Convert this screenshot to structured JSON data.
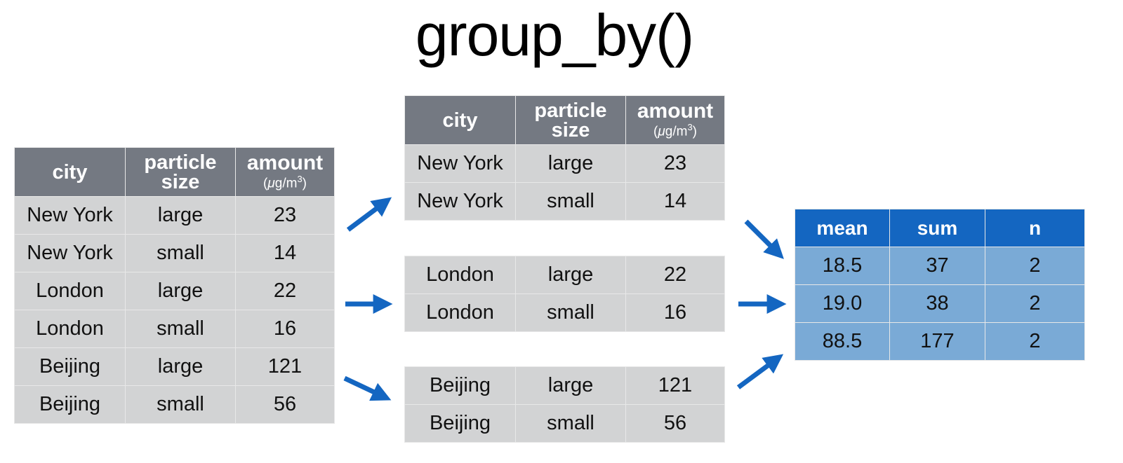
{
  "title": "group_by()",
  "columns": {
    "city": "city",
    "particle_size_line1": "particle",
    "particle_size_line2": "size",
    "amount": "amount",
    "amount_unit_prefix": "(",
    "amount_unit_mu": "μ",
    "amount_unit_mid": "g/m",
    "amount_unit_exp": "3",
    "amount_unit_suffix": ")"
  },
  "source_table": {
    "rows": [
      {
        "city": "New York",
        "size": "large",
        "amount": "23"
      },
      {
        "city": "New York",
        "size": "small",
        "amount": "14"
      },
      {
        "city": "London",
        "size": "large",
        "amount": "22"
      },
      {
        "city": "London",
        "size": "small",
        "amount": "16"
      },
      {
        "city": "Beijing",
        "size": "large",
        "amount": "121"
      },
      {
        "city": "Beijing",
        "size": "small",
        "amount": "56"
      }
    ]
  },
  "groups": [
    {
      "rows": [
        {
          "city": "New York",
          "size": "large",
          "amount": "23"
        },
        {
          "city": "New York",
          "size": "small",
          "amount": "14"
        }
      ]
    },
    {
      "rows": [
        {
          "city": "London",
          "size": "large",
          "amount": "22"
        },
        {
          "city": "London",
          "size": "small",
          "amount": "16"
        }
      ]
    },
    {
      "rows": [
        {
          "city": "Beijing",
          "size": "large",
          "amount": "121"
        },
        {
          "city": "Beijing",
          "size": "small",
          "amount": "56"
        }
      ]
    }
  ],
  "summary_table": {
    "headers": [
      "mean",
      "sum",
      "n"
    ],
    "rows": [
      [
        "18.5",
        "37",
        "2"
      ],
      [
        "19.0",
        "38",
        "2"
      ],
      [
        "88.5",
        "177",
        "2"
      ]
    ]
  },
  "colors": {
    "header_gray": "#747982",
    "cell_gray": "#d2d3d4",
    "header_blue": "#1466c1",
    "cell_blue": "#7aaad6",
    "arrow": "#1466c1"
  }
}
